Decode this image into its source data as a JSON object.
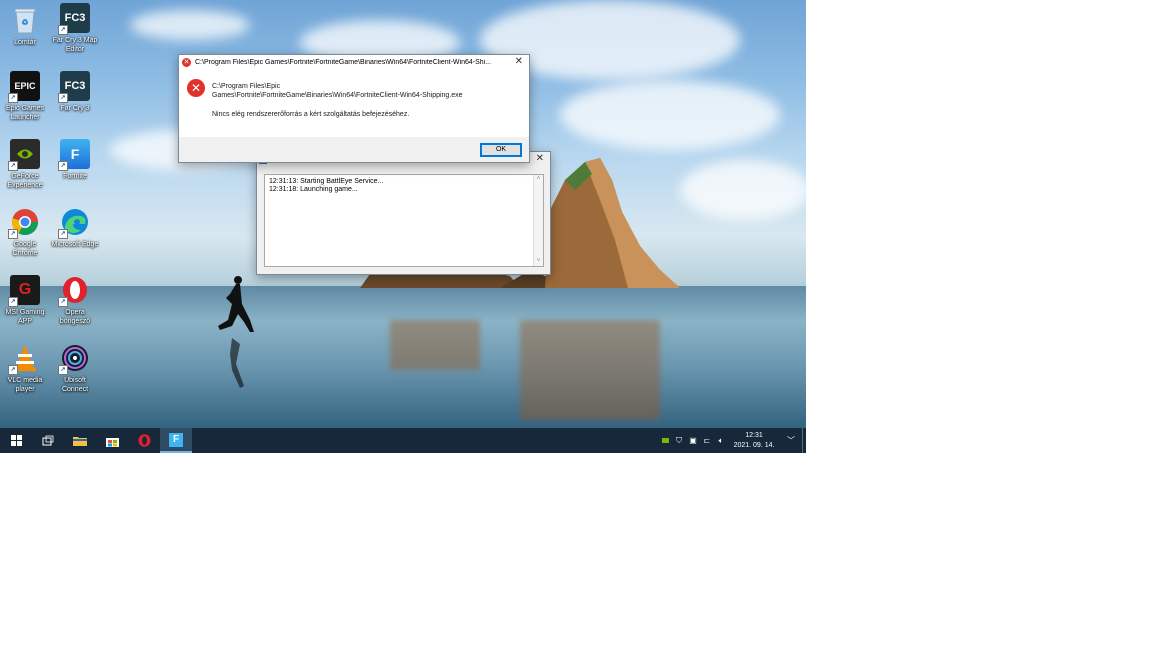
{
  "desktop_icons": [
    {
      "label": "Lomtár",
      "icon": "recycle-bin-icon"
    },
    {
      "label": "Far Cry 3 Map Editor",
      "icon": "fc3-map-editor-icon",
      "badge": "FC3"
    },
    {
      "label": "Epic Games Launcher",
      "icon": "epic-games-icon",
      "badge": "EPIC"
    },
    {
      "label": "Far Cry 3",
      "icon": "far-cry-3-icon",
      "badge": "FC3"
    },
    {
      "label": "GeForce Experience",
      "icon": "geforce-icon"
    },
    {
      "label": "Fortnite",
      "icon": "fortnite-icon",
      "badge": "F"
    },
    {
      "label": "Google Chrome",
      "icon": "chrome-icon"
    },
    {
      "label": "Microsoft Edge",
      "icon": "edge-icon"
    },
    {
      "label": "MSI Gaming APP",
      "icon": "msi-gaming-icon"
    },
    {
      "label": "Opera böngésző",
      "icon": "opera-icon"
    },
    {
      "label": "VLC media player",
      "icon": "vlc-icon"
    },
    {
      "label": "Ubisoft Connect",
      "icon": "ubisoft-icon"
    }
  ],
  "error_dialog": {
    "title": "C:\\Program Files\\Epic Games\\Fortnite\\FortniteGame\\Binaries\\Win64\\FortniteClient-Win64-Shi...",
    "path_line1": "C:\\Program Files\\Epic",
    "path_line2": "Games\\Fortnite\\FortniteGame\\Binaries\\Win64\\FortniteClient-Win64-Shipping.exe",
    "message": "Nincs elég rendszererőforrás a kért szolgáltatás befejezéséhez.",
    "ok_label": "OK",
    "close_glyph": "✕",
    "icon_glyph": "✕"
  },
  "launcher_window": {
    "close_glyph": "✕",
    "log_lines": [
      "12:31:13: Starting BattlEye Service...",
      "12:31:18: Launching game..."
    ]
  },
  "taskbar": {
    "clock_time": "12:31",
    "clock_date": "2021. 09. 14."
  },
  "colors": {
    "taskbar_bg": "#16283a",
    "error_red": "#e0322a",
    "ok_border": "#0078d7"
  }
}
